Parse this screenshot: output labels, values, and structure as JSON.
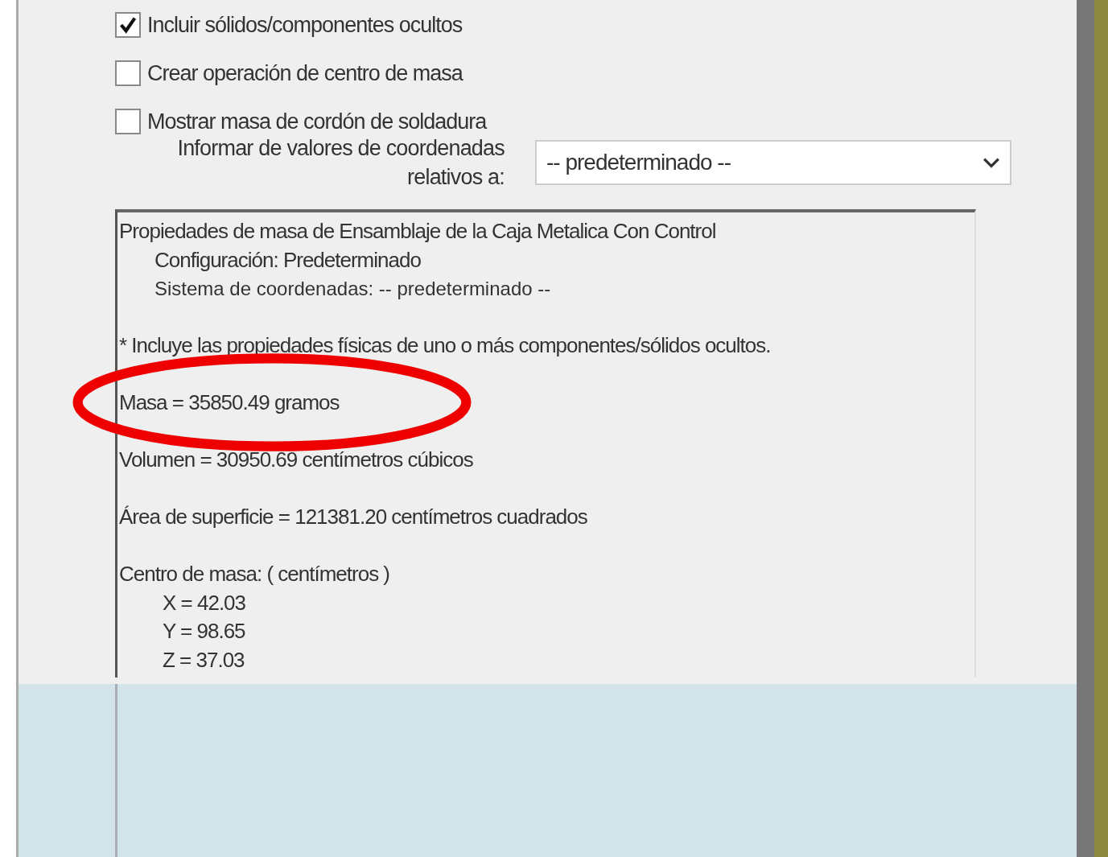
{
  "options": [
    {
      "label": "Incluir sólidos/componentes ocultos",
      "checked": true
    },
    {
      "label": "Crear operación de centro de masa",
      "checked": false
    },
    {
      "label": "Mostrar masa de cordón de soldadura",
      "checked": false
    }
  ],
  "coordinates": {
    "label_lines": [
      "Informar de valores de coordenadas",
      "relativos a:"
    ],
    "value": "-- predeterminado --"
  },
  "report": {
    "title": "Propiedades de masa de Ensamblaje de la Caja Metalica Con Control",
    "configuration": "Configuración:  Predeterminado",
    "coordinate_system": "Sistema de coordenadas:   -- predeterminado --",
    "note": "* Incluye las propiedades físicas de uno o más componentes/sólidos ocultos.",
    "mass": "Masa = 35850.49 gramos",
    "volume": "Volumen = 30950.69  centímetros cúbicos",
    "area": "Área de superficie = 121381.20  centímetros cuadrados",
    "center_title": "Centro de masa: ( centímetros )",
    "center": [
      "X = 42.03",
      "Y = 98.65",
      "Z = 37.03"
    ]
  }
}
